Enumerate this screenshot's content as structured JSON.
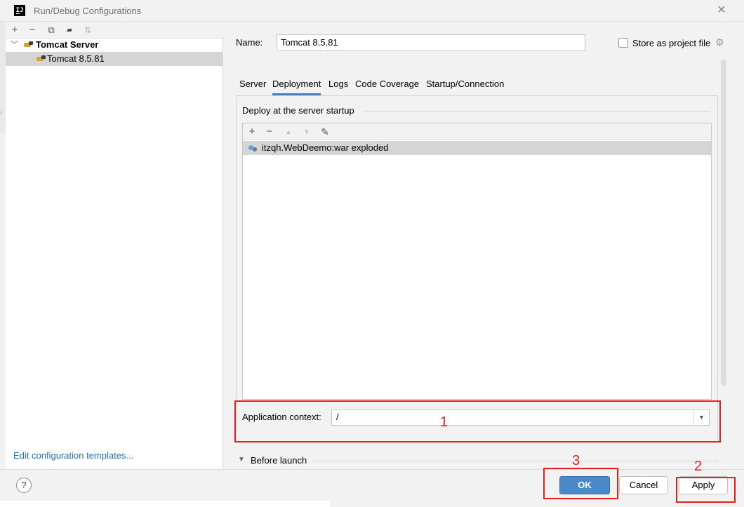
{
  "window": {
    "title": "Run/Debug Configurations",
    "app_icon_text": "IJ"
  },
  "left": {
    "toolbar": {
      "add": "+",
      "remove": "−",
      "copy": "⧉",
      "folder": "▰",
      "sort": "⇅"
    },
    "tree": {
      "group_label": "Tomcat Server",
      "child_label": "Tomcat 8.5.81"
    },
    "edit_templates": "Edit configuration templates..."
  },
  "main": {
    "name_label": "Name:",
    "name_value": "Tomcat 8.5.81",
    "store_label": "Store as project file",
    "store_checked": false,
    "tabs": [
      "Server",
      "Deployment",
      "Logs",
      "Code Coverage",
      "Startup/Connection"
    ],
    "active_tab": "Deployment",
    "deploy_section": "Deploy at the server startup",
    "artifacts": [
      "itzqh.WebDeemo:war exploded"
    ],
    "app_context_label": "Application context:",
    "app_context_value": "/",
    "before_launch": "Before launch"
  },
  "buttons": {
    "help": "?",
    "ok": "OK",
    "cancel": "Cancel",
    "apply": "Apply"
  },
  "annotations": [
    "1",
    "2",
    "3"
  ],
  "colors": {
    "accent": "#4a89c8",
    "annotation": "#e8201c",
    "link": "#2470b3"
  }
}
